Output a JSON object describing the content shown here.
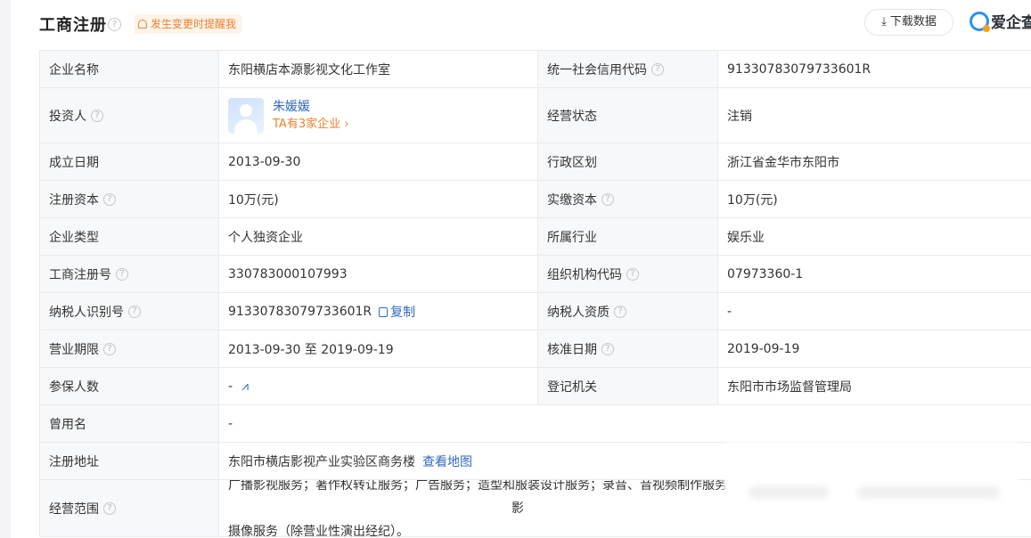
{
  "header": {
    "title": "工商注册",
    "alert_label": "发生变更时提醒我",
    "download_label": "下载数据",
    "brand_label": "爱企查"
  },
  "rows": {
    "company_name": {
      "label": "企业名称",
      "value": "东阳横店本源影视文化工作室"
    },
    "credit_code": {
      "label": "统一社会信用代码",
      "value": "91330783079733601R"
    },
    "investor": {
      "label": "投资人",
      "name": "朱媛媛",
      "sub": "TA有3家企业 ›"
    },
    "status": {
      "label": "经营状态",
      "value": "注销"
    },
    "found_date": {
      "label": "成立日期",
      "value": "2013-09-30"
    },
    "region": {
      "label": "行政区划",
      "value": "浙江省金华市东阳市"
    },
    "reg_capital": {
      "label": "注册资本",
      "value": "10万(元)"
    },
    "paid_capital": {
      "label": "实缴资本",
      "value": "10万(元)"
    },
    "company_type": {
      "label": "企业类型",
      "value": "个人独资企业"
    },
    "industry": {
      "label": "所属行业",
      "value": "娱乐业"
    },
    "reg_no": {
      "label": "工商注册号",
      "value": "330783000107993"
    },
    "org_code": {
      "label": "组织机构代码",
      "value": "07973360-1"
    },
    "tax_id": {
      "label": "纳税人识别号",
      "value": "91330783079733601R",
      "copy_label": "复制"
    },
    "tax_qual": {
      "label": "纳税人资质",
      "value": "-"
    },
    "term": {
      "label": "营业期限",
      "value": "2013-09-30 至 2019-09-19"
    },
    "approve_date": {
      "label": "核准日期",
      "value": "2019-09-19"
    },
    "insured": {
      "label": "参保人数",
      "value": "-"
    },
    "authority": {
      "label": "登记机关",
      "value": "东阳市市场监督管理局"
    },
    "former_name": {
      "label": "曾用名",
      "value": "-"
    },
    "address": {
      "label": "注册地址",
      "value": "东阳市横店影视产业实验区商务楼",
      "map_label": "查看地图"
    },
    "scope": {
      "label": "经营范围",
      "value": "广播影视服务；著作权转让服务；广告服务；造型和服装设计服务；录音、音视频制作服务",
      "value_tail": "影",
      "value_line2": "摄像服务（除营业性演出经纪）。"
    }
  },
  "icons": {
    "help": "?",
    "download": "⤓",
    "trend": "⩘"
  },
  "colors": {
    "link": "#2f6ac0",
    "alert": "#ef7f2d",
    "label_bg": "#f7f8fa",
    "border": "#e8eaec"
  }
}
